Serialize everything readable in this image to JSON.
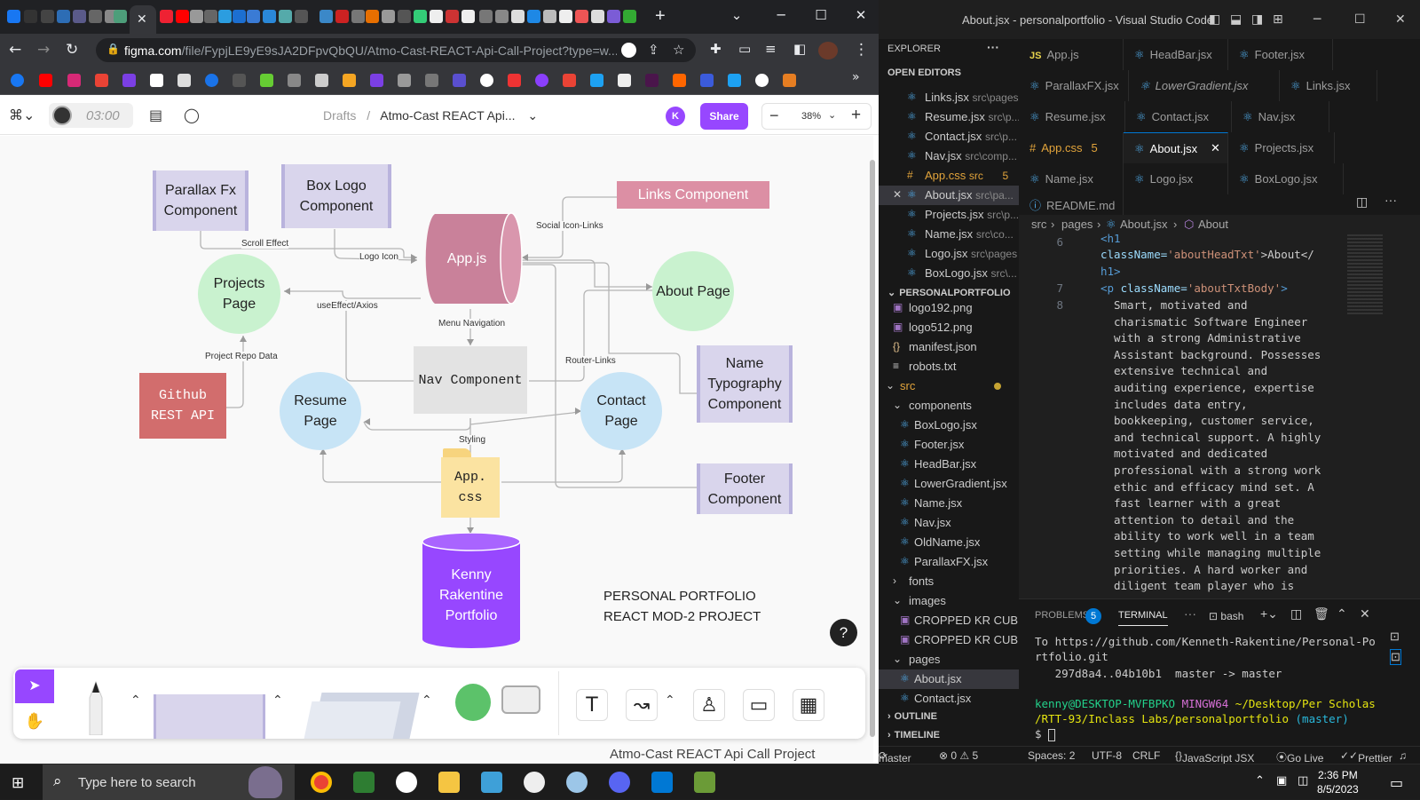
{
  "chrome": {
    "tab_close": "✕",
    "new_tab": "+",
    "url_host": "figma.com",
    "url_path": "/file/FypjLE9yE9sJA2DFpvQbQU/Atmo-Cast-REACT-Api-Call-Project?type=w..."
  },
  "figma": {
    "timer": "03:00",
    "breadcrumb_folder": "Drafts",
    "breadcrumb_sep": "/",
    "file_name": "Atmo-Cast REACT Api...",
    "avatar_initial": "K",
    "share_label": "Share",
    "zoom": "38%",
    "help": "?",
    "footer_title": "Atmo-Cast REACT Api Call Project",
    "diagram": {
      "parallax": "Parallax Fx Component",
      "boxlogo": "Box Logo Component",
      "appjs": "App.js",
      "links": "Links Component",
      "projects": "Projects Page",
      "about": "About Page",
      "nav": "Nav Component",
      "github": "Github REST API",
      "resume": "Resume Page",
      "contact": "Contact Page",
      "name": "Name Typography Component",
      "footer": "Footer Component",
      "appcss": "App. css",
      "kenny": "Kenny Rakentine Portfolio",
      "label_scroll": "Scroll Effect",
      "label_logo": "Logo Icon",
      "label_social": "Social Icon-Links",
      "label_useeffect": "useEffect/Axios",
      "label_menu": "Menu Navigation",
      "label_repo": "Project Repo Data",
      "label_router": "Router-Links",
      "label_styling": "Styling",
      "title_line1": "PERSONAL PORTFOLIO",
      "title_line2": "REACT MOD-2 PROJECT"
    }
  },
  "vscode": {
    "title": "About.jsx - personalportfolio - Visual Studio Code",
    "explorer": "EXPLORER",
    "open_editors": "OPEN EDITORS",
    "open_files": [
      {
        "name": "Links.jsx",
        "path": "src\\pages"
      },
      {
        "name": "Resume.jsx",
        "path": "src\\p..."
      },
      {
        "name": "Contact.jsx",
        "path": "src\\p..."
      },
      {
        "name": "Nav.jsx",
        "path": "src\\comp..."
      },
      {
        "name": "App.css",
        "path": "src",
        "badge": "5"
      },
      {
        "name": "About.jsx",
        "path": "src\\pa..."
      },
      {
        "name": "Projects.jsx",
        "path": "src\\p..."
      },
      {
        "name": "Name.jsx",
        "path": "src\\co..."
      },
      {
        "name": "Logo.jsx",
        "path": "src\\pages"
      },
      {
        "name": "BoxLogo.jsx",
        "path": "src\\..."
      }
    ],
    "project": "PERSONALPORTFOLIO",
    "tree": [
      "logo192.png",
      "logo512.png",
      "manifest.json",
      "robots.txt",
      "src",
      "components",
      "BoxLogo.jsx",
      "Footer.jsx",
      "HeadBar.jsx",
      "LowerGradient.jsx",
      "Name.jsx",
      "Nav.jsx",
      "OldName.jsx",
      "ParallaxFX.jsx",
      "fonts",
      "images",
      "CROPPED KR CUBE...",
      "CROPPED KR CUBE...",
      "pages",
      "About.jsx",
      "Contact.jsx"
    ],
    "outline": "OUTLINE",
    "timeline": "TIMELINE",
    "tabs": [
      "App.js",
      "HeadBar.jsx",
      "Footer.jsx",
      "ParallaxFX.jsx",
      "LowerGradient.jsx",
      "Links.jsx",
      "Resume.jsx",
      "Contact.jsx",
      "Nav.jsx",
      "App.css",
      "About.jsx",
      "Projects.jsx",
      "Name.jsx",
      "Logo.jsx",
      "BoxLogo.jsx",
      "README.md"
    ],
    "appcss_badge": "5",
    "breadcrumb": [
      "src",
      "pages",
      "About.jsx",
      "About"
    ],
    "code": {
      "ln6": "6",
      "ln7": "7",
      "ln8": "8",
      "l1": "<h1",
      "l2a": "className=",
      "l2b": "'aboutHeadTxt'",
      "l2c": ">About</",
      "l3": "h1>",
      "l4a": "<p ",
      "l4b": "className=",
      "l4c": "'aboutTxtBody'",
      "l4d": ">",
      "body": [
        "Smart, motivated and",
        "charismatic Software Engineer",
        "with a strong Administrative",
        "Assistant background. Possesses",
        "extensive technical and",
        "auditing experience, expertise",
        "includes data entry,",
        "bookkeeping, customer service,",
        "and technical support. A highly",
        "motivated and dedicated",
        "professional with a strong work",
        "ethic and efficacy mind set. A",
        "fast learner with a great",
        "attention to detail and the",
        "ability to work well in a team",
        "setting while managing multiple",
        "priorities. A hard worker and",
        "diligent team player who is"
      ]
    },
    "panel": {
      "problems": "PROBLEMS",
      "problems_count": "5",
      "terminal": "TERMINAL",
      "more": "···",
      "shell": "bash",
      "t1": "To https://github.com/Kenneth-Rakentine/Personal-Po",
      "t2": "rtfolio.git",
      "t3": "   297d8a4..04b10b1  master -> master",
      "t4_user": "kenny@DESKTOP-MVFBPKO",
      "t4_sys": "MINGW64",
      "t4_path": "~/Desktop/Per Scholas",
      "t5_path": "/RTT-93/Inclass Labs/personalportfolio",
      "t5_branch": "(master)",
      "t6": "$ "
    },
    "status": {
      "branch": "master",
      "errors": "⊗ 0 ⚠ 5",
      "spaces": "Spaces: 2",
      "enc": "UTF-8",
      "eol": "CRLF",
      "lang": "JavaScript JSX",
      "live": "Go Live",
      "prettier": "Prettier"
    }
  },
  "taskbar": {
    "search_placeholder": "Type here to search",
    "time": "2:36 PM",
    "date": "8/5/2023"
  },
  "colors": {
    "figma_purple": "#9747ff",
    "app_js": "#c9819a",
    "links_component": "#dc8fa4",
    "github": "#d26d6d",
    "app_css": "#fbe3a1",
    "kenny_db": "#9747ff"
  }
}
